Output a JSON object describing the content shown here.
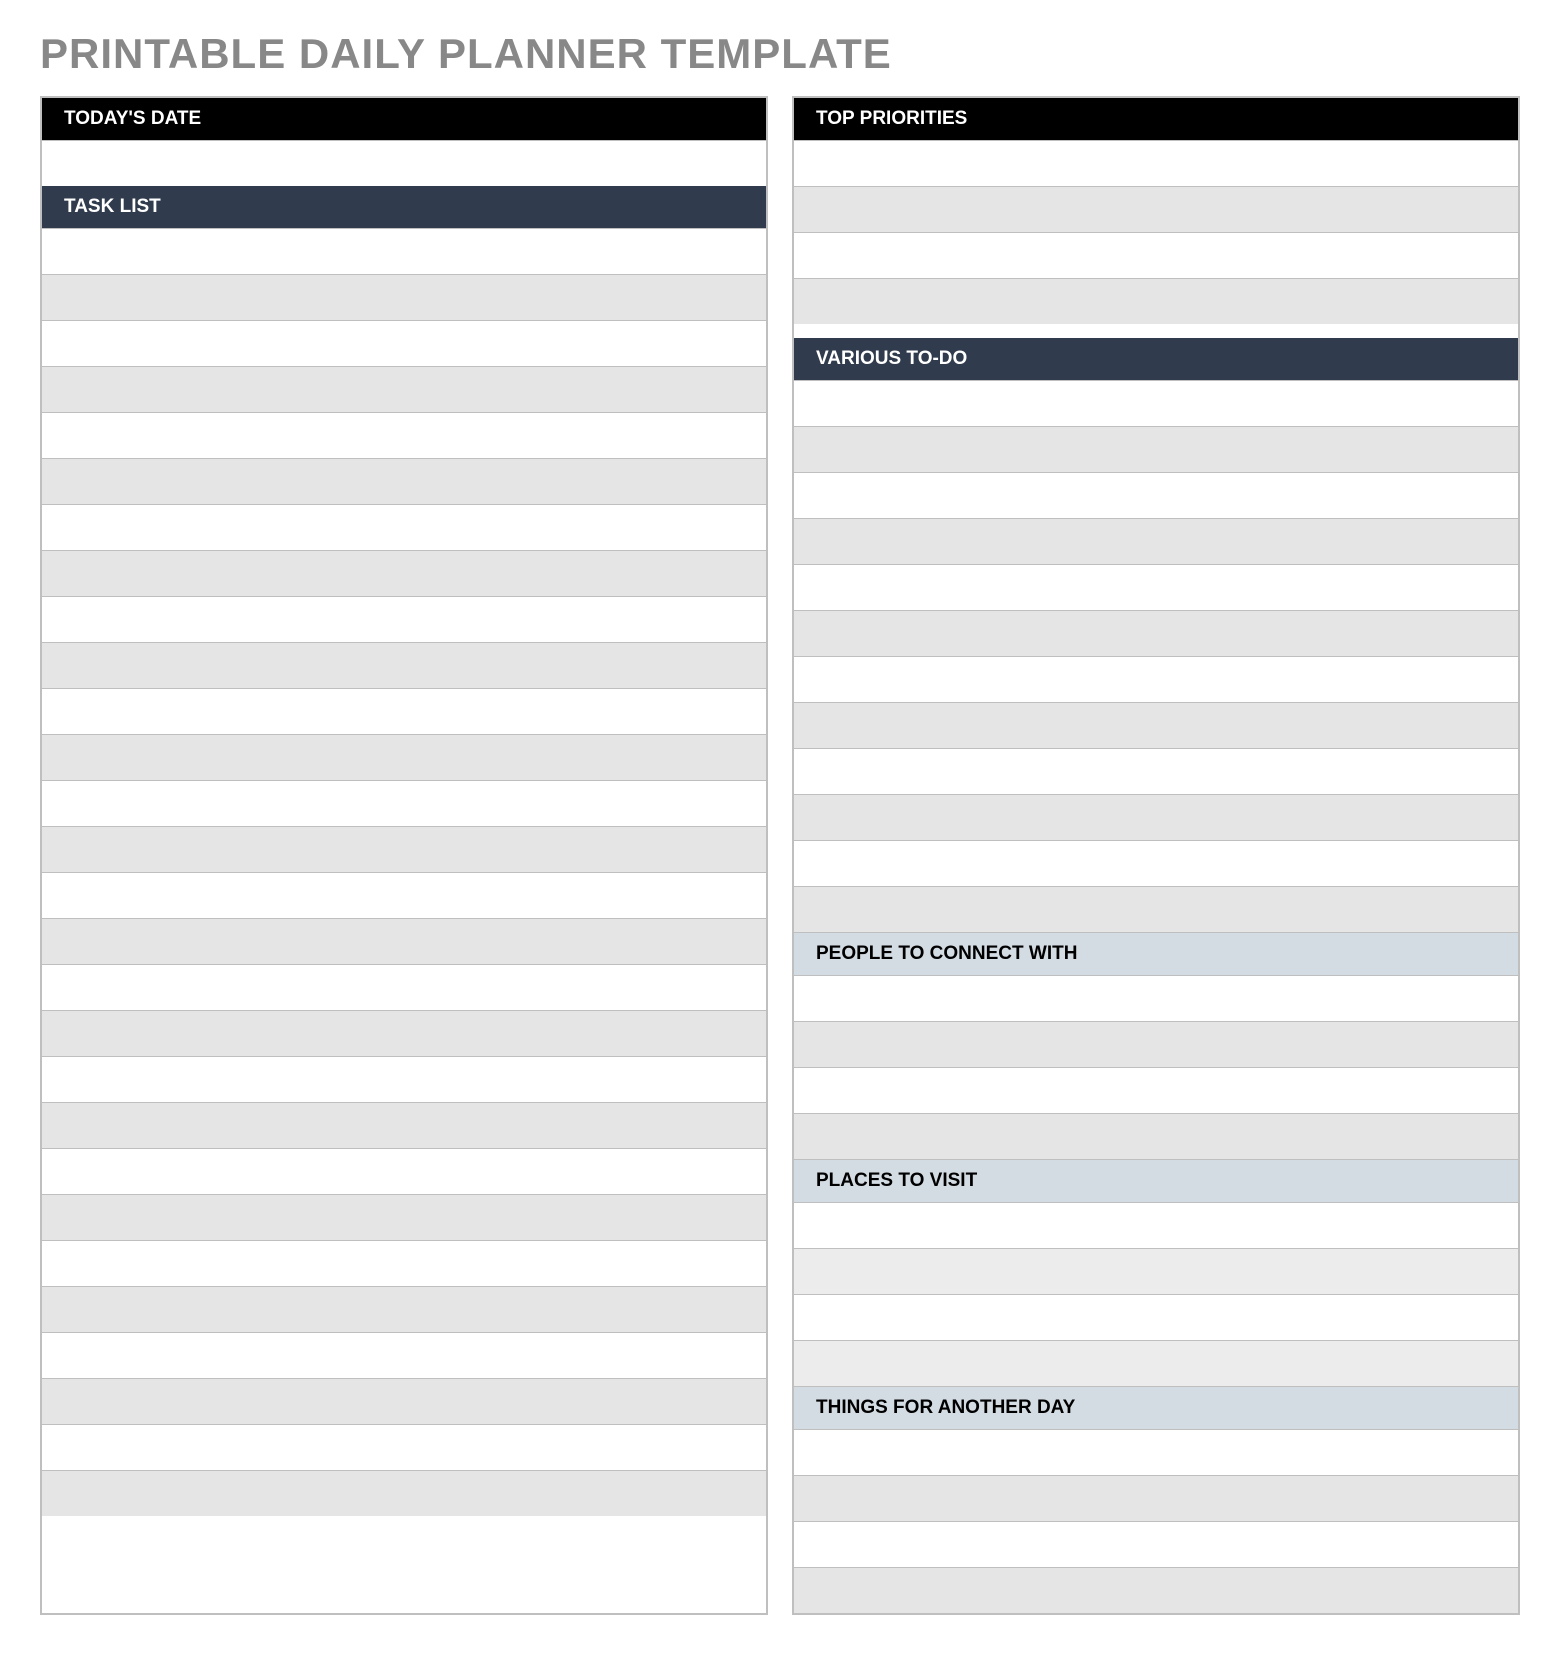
{
  "title": "PRINTABLE DAILY PLANNER TEMPLATE",
  "left": {
    "todays_date_label": "TODAY'S DATE",
    "task_list_label": "TASK LIST"
  },
  "right": {
    "top_priorities_label": "TOP PRIORITIES",
    "various_todo_label": "VARIOUS TO-DO",
    "people_label": "PEOPLE TO CONNECT WITH",
    "places_label": "PLACES TO VISIT",
    "things_label": "THINGS FOR ANOTHER DAY"
  }
}
